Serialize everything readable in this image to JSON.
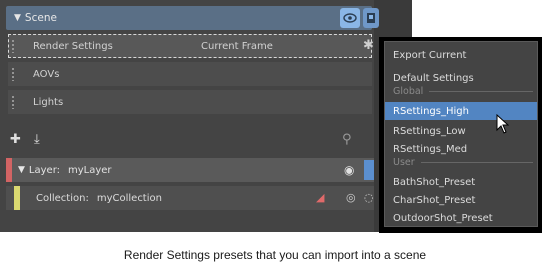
{
  "scene": {
    "label": "Scene"
  },
  "rows": [
    {
      "label": "Render Settings",
      "value": "Current Frame"
    },
    {
      "label": "AOVs"
    },
    {
      "label": "Lights"
    }
  ],
  "layer": {
    "prefix": "Layer:",
    "name": "myLayer"
  },
  "collection": {
    "prefix": "Collection:",
    "name": "myCollection"
  },
  "menu": {
    "export": "Export Current",
    "default": "Default Settings",
    "global_header": "Global",
    "global_items": [
      "RSettings_High",
      "RSettings_Low",
      "RSettings_Med"
    ],
    "user_header": "User",
    "user_items": [
      "BathShot_Preset",
      "CharShot_Preset",
      "OutdoorShot_Preset"
    ],
    "highlight_color": "#5285c2"
  },
  "caption": "Render Settings presets that you can import into a scene"
}
